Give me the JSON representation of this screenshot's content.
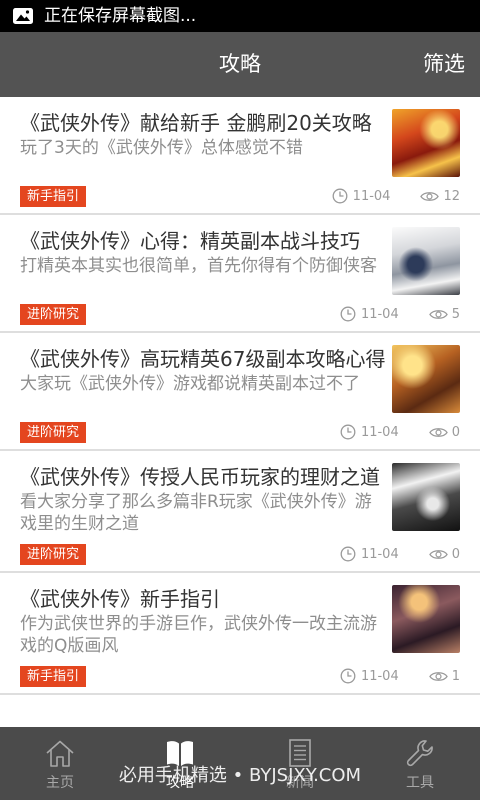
{
  "theme": {
    "status_bar_bg": "#000000",
    "header_bg": "#535353",
    "tag_bg": "#e4461f",
    "tab_bar_bg": "#4b4b4b",
    "tab_active": "#ffffff",
    "tab_inactive": "#a8a8a8"
  },
  "status_bar": {
    "icon": "image-icon",
    "text": "正在保存屏幕截图..."
  },
  "header": {
    "title": "攻略",
    "filter_label": "筛选"
  },
  "meta_icons": {
    "date": "clock-icon",
    "views": "eye-icon"
  },
  "articles": [
    {
      "title": "《武侠外传》献给新手 金鹏刷20关攻略",
      "summary": "玩了3天的《武侠外传》总体感觉不错",
      "tag": "新手指引",
      "date": "11-04",
      "views": "12"
    },
    {
      "title": "《武侠外传》心得：精英副本战斗技巧",
      "summary": "打精英本其实也很简单，首先你得有个防御侠客",
      "tag": "进阶研究",
      "date": "11-04",
      "views": "5"
    },
    {
      "title": "《武侠外传》高玩精英67级副本攻略心得",
      "summary": "大家玩《武侠外传》游戏都说精英副本过不了",
      "tag": "进阶研究",
      "date": "11-04",
      "views": "0"
    },
    {
      "title": "《武侠外传》传授人民币玩家的理财之道",
      "summary": "看大家分享了那么多篇非R玩家《武侠外传》游戏里的生财之道",
      "tag": "进阶研究",
      "date": "11-04",
      "views": "0"
    },
    {
      "title": "《武侠外传》新手指引",
      "summary": "作为武侠世界的手游巨作，武侠外传一改主流游戏的Q版画风",
      "tag": "新手指引",
      "date": "11-04",
      "views": "1"
    }
  ],
  "tab_bar": {
    "tabs": [
      {
        "label": "主页",
        "icon": "home-icon",
        "active": false
      },
      {
        "label": "攻略",
        "icon": "book-icon",
        "active": true
      },
      {
        "label": "新闻",
        "icon": "news-icon",
        "active": false
      },
      {
        "label": "工具",
        "icon": "wrench-icon",
        "active": false
      }
    ]
  },
  "watermark": {
    "text": "必用手机精选 • BYJSJXY.COM"
  }
}
